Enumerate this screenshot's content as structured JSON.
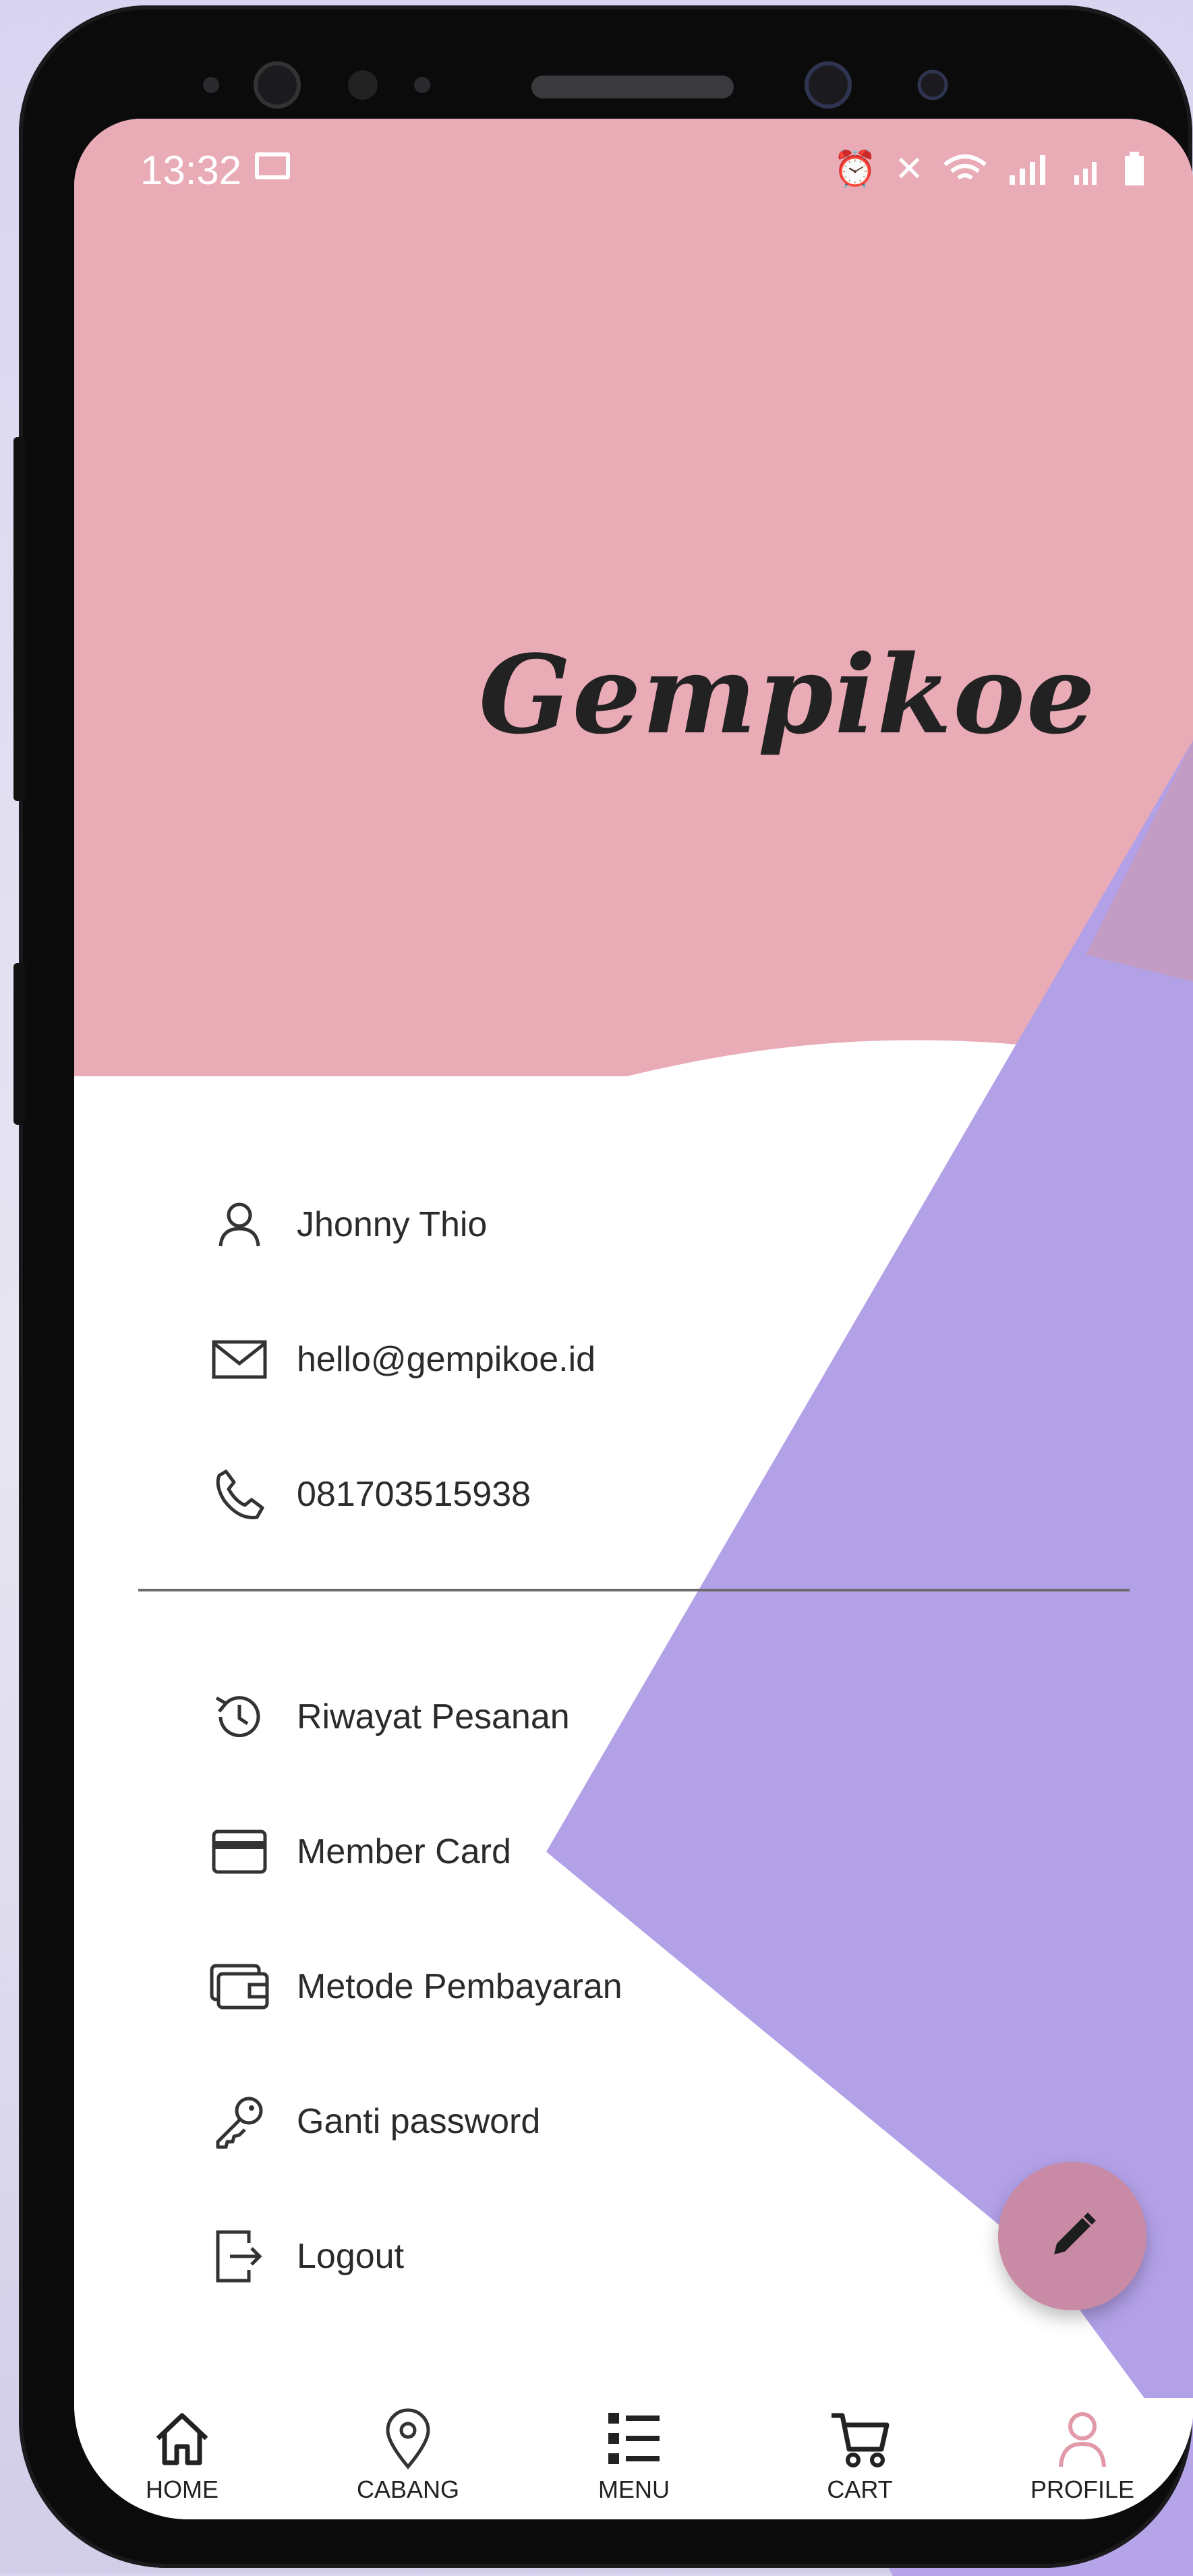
{
  "colors": {
    "accent_pink": "#e9abb6",
    "accent_purple": "#b3a1e8",
    "fab": "#c98aa5"
  },
  "statusbar": {
    "time": "13:32"
  },
  "app": {
    "logo_text": "Gempikoe"
  },
  "profile": [
    {
      "icon": "user-icon",
      "label": "Jhonny Thio"
    },
    {
      "icon": "mail-icon",
      "label": "hello@gempikoe.id"
    },
    {
      "icon": "phone-icon",
      "label": "081703515938"
    }
  ],
  "menu": [
    {
      "icon": "history-icon",
      "label": "Riwayat Pesanan"
    },
    {
      "icon": "card-icon",
      "label": "Member Card"
    },
    {
      "icon": "wallet-icon",
      "label": "Metode Pembayaran"
    },
    {
      "icon": "key-icon",
      "label": "Ganti password"
    },
    {
      "icon": "logout-icon",
      "label": "Logout"
    }
  ],
  "fab": {
    "icon": "pencil-icon"
  },
  "nav": [
    {
      "icon": "home-icon",
      "label": "HOME"
    },
    {
      "icon": "location-pin-icon",
      "label": "CABANG"
    },
    {
      "icon": "list-icon",
      "label": "MENU"
    },
    {
      "icon": "cart-icon",
      "label": "CART"
    },
    {
      "icon": "user-icon",
      "label": "PROFILE",
      "active": true
    }
  ]
}
